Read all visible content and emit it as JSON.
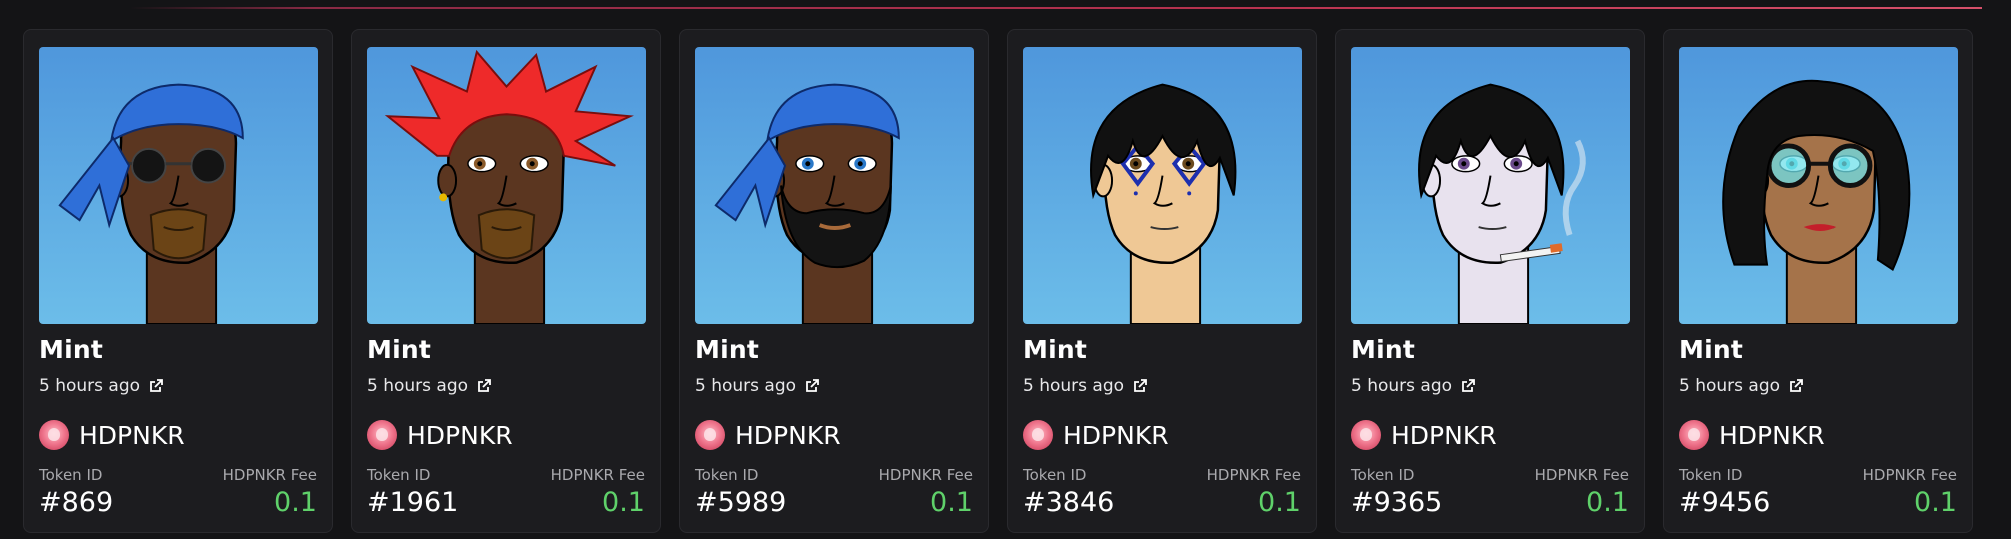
{
  "cards": [
    {
      "title": "Mint",
      "time": "5 hours ago",
      "collection": "HDPNKR",
      "token_label": "Token ID",
      "token_id": "#869",
      "fee_label": "HDPNKR Fee",
      "fee": "0.1",
      "avatar": {
        "skin": "#5b3620",
        "hair": "bandana",
        "hair_color": "#2f6fd8",
        "glasses": "sunglasses",
        "beard": "goatee",
        "smoke": false,
        "lips": false,
        "eyes": "hidden"
      }
    },
    {
      "title": "Mint",
      "time": "5 hours ago",
      "collection": "HDPNKR",
      "token_label": "Token ID",
      "token_id": "#1961",
      "fee_label": "HDPNKR Fee",
      "fee": "0.1",
      "avatar": {
        "skin": "#5b3620",
        "hair": "spiky",
        "hair_color": "#ee2a2a",
        "glasses": "none",
        "beard": "goatee",
        "smoke": false,
        "lips": false,
        "eyes": "#8a5a2a"
      }
    },
    {
      "title": "Mint",
      "time": "5 hours ago",
      "collection": "HDPNKR",
      "token_label": "Token ID",
      "token_id": "#5989",
      "fee_label": "HDPNKR Fee",
      "fee": "0.1",
      "avatar": {
        "skin": "#5b3620",
        "hair": "bandana",
        "hair_color": "#2f6fd8",
        "glasses": "none",
        "beard": "full",
        "smoke": false,
        "lips": false,
        "eyes": "#2a78c8"
      }
    },
    {
      "title": "Mint",
      "time": "5 hours ago",
      "collection": "HDPNKR",
      "token_label": "Token ID",
      "token_id": "#3846",
      "fee_label": "HDPNKR Fee",
      "fee": "0.1",
      "avatar": {
        "skin": "#efc895",
        "hair": "emo",
        "hair_color": "#111111",
        "glasses": "none",
        "beard": "none",
        "smoke": false,
        "lips": false,
        "eyes": "#6b4a1e",
        "facepaint": true
      }
    },
    {
      "title": "Mint",
      "time": "5 hours ago",
      "collection": "HDPNKR",
      "token_label": "Token ID",
      "token_id": "#9365",
      "fee_label": "HDPNKR Fee",
      "fee": "0.1",
      "avatar": {
        "skin": "#e8e2ee",
        "hair": "emo",
        "hair_color": "#111111",
        "glasses": "none",
        "beard": "none",
        "smoke": true,
        "lips": false,
        "eyes": "#6a4a8a"
      }
    },
    {
      "title": "Mint",
      "time": "5 hours ago",
      "collection": "HDPNKR",
      "token_label": "Token ID",
      "token_id": "#9456",
      "fee_label": "HDPNKR Fee",
      "fee": "0.1",
      "avatar": {
        "skin": "#a5734a",
        "hair": "bob",
        "hair_color": "#111111",
        "glasses": "round-cyan",
        "beard": "none",
        "smoke": false,
        "lips": true,
        "eyes": "#39c6d6"
      }
    }
  ],
  "colors": {
    "background": "#141416",
    "card": "#1c1c1f",
    "fee": "#5fd16a",
    "muted": "#a9a9ad",
    "accent_line": "#b8324f"
  },
  "icons": {
    "time_link": "external-link-icon",
    "collection": "hdpnkr-logo-icon"
  }
}
